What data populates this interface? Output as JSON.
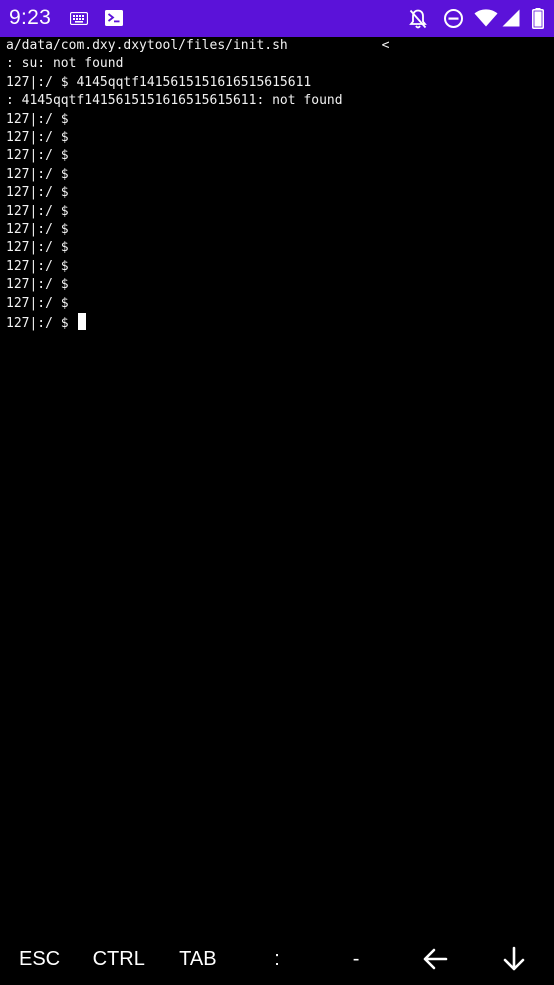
{
  "status_bar": {
    "time": "9:23",
    "icons": [
      "keyboard-icon",
      "terminal-icon",
      "notifications-off-icon",
      "do-not-disturb-icon",
      "wifi-icon",
      "cellular-signal-icon",
      "battery-icon"
    ],
    "background_color": "#5b12d9"
  },
  "terminal": {
    "background_color": "#000000",
    "text_color": "#f2f2f2",
    "lines": [
      "a/data/com.dxy.dxytool/files/init.sh            <",
      ": su: not found",
      "127|:/ $ 4145qqtf1415615151616515615611",
      ": 4145qqtf1415615151616515615611: not found",
      "127|:/ $",
      "127|:/ $",
      "127|:/ $",
      "127|:/ $",
      "127|:/ $",
      "127|:/ $",
      "127|:/ $",
      "127|:/ $",
      "127|:/ $",
      "127|:/ $",
      "127|:/ $"
    ],
    "prompt_line": "127|:/ $ "
  },
  "extra_keys": {
    "esc": "ESC",
    "ctrl": "CTRL",
    "tab": "TAB",
    "colon": ":",
    "dash": "-",
    "left_arrow_icon": "arrow-left-icon",
    "down_arrow_icon": "arrow-down-icon"
  }
}
